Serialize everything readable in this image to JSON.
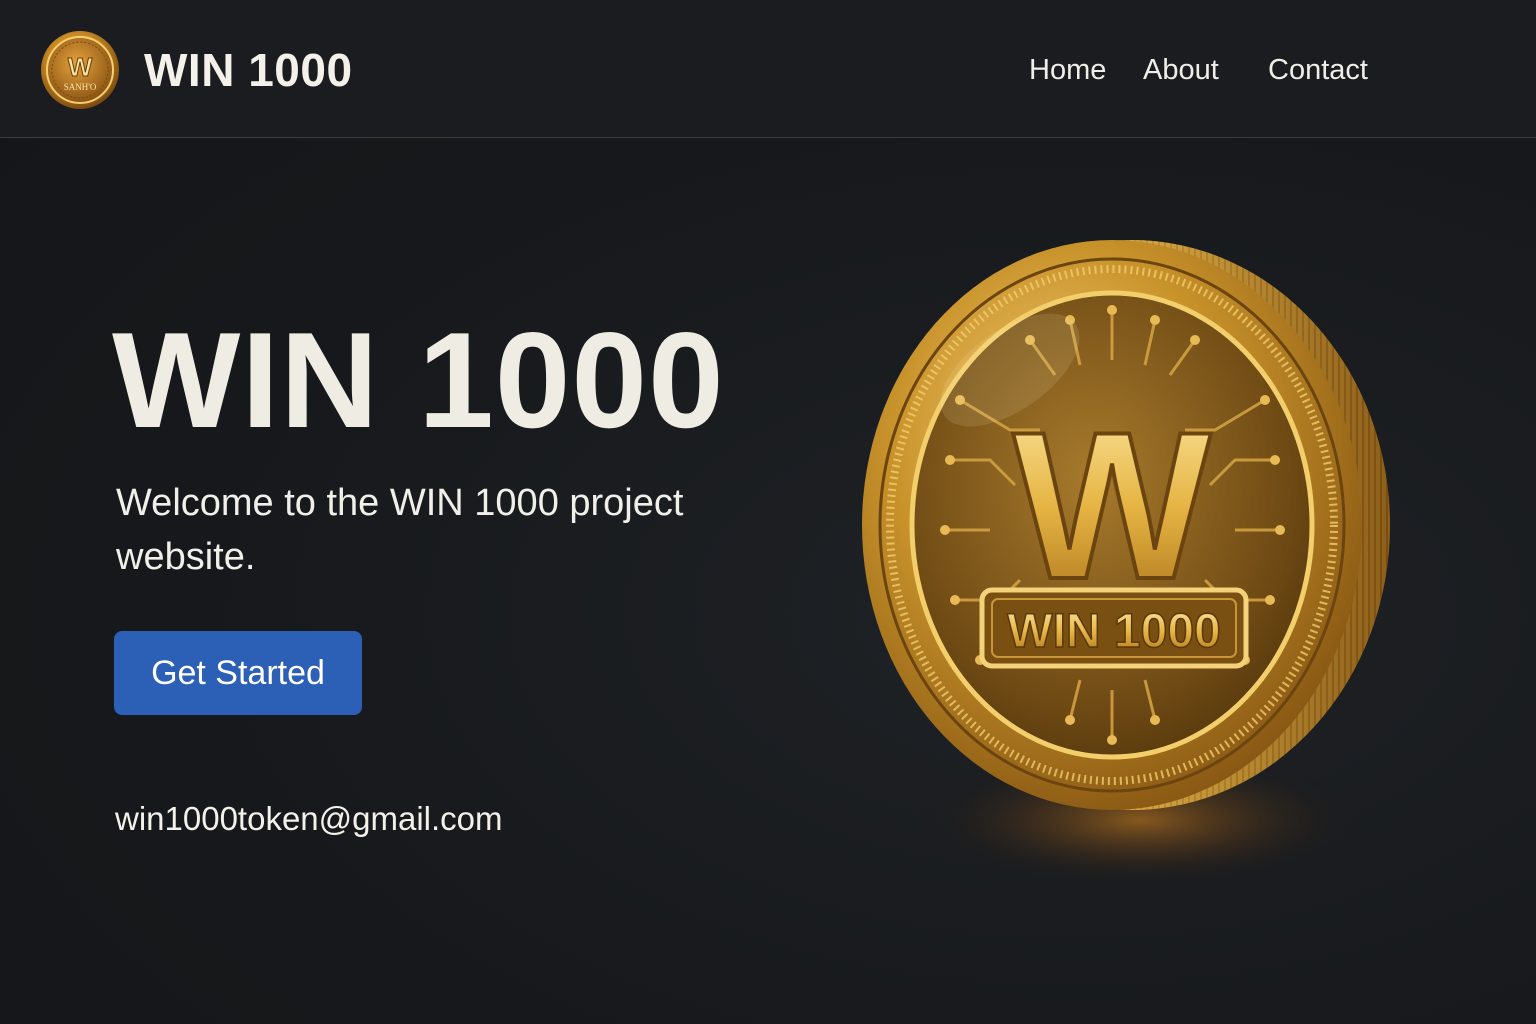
{
  "header": {
    "logo_icon": "coin-logo-icon",
    "logo_letter": "W",
    "logo_small_text": "SANH'O",
    "brand": "WIN 1000",
    "nav": [
      {
        "label": "Home"
      },
      {
        "label": "About"
      },
      {
        "label": "Contact"
      }
    ]
  },
  "hero": {
    "title": "WIN 1000",
    "subtitle": "Welcome to the WIN 1000 project website.",
    "cta_label": "Get Started",
    "email": "win1000token@gmail.com"
  },
  "coin": {
    "icon": "gold-coin-illustration",
    "letter": "W",
    "plate_text": "WIN 1000"
  },
  "colors": {
    "background": "#16181b",
    "navbar": "#1b1c1f",
    "accent_blue": "#2c5fb6",
    "gold": "#d4a12a",
    "text": "#f1efe9"
  }
}
